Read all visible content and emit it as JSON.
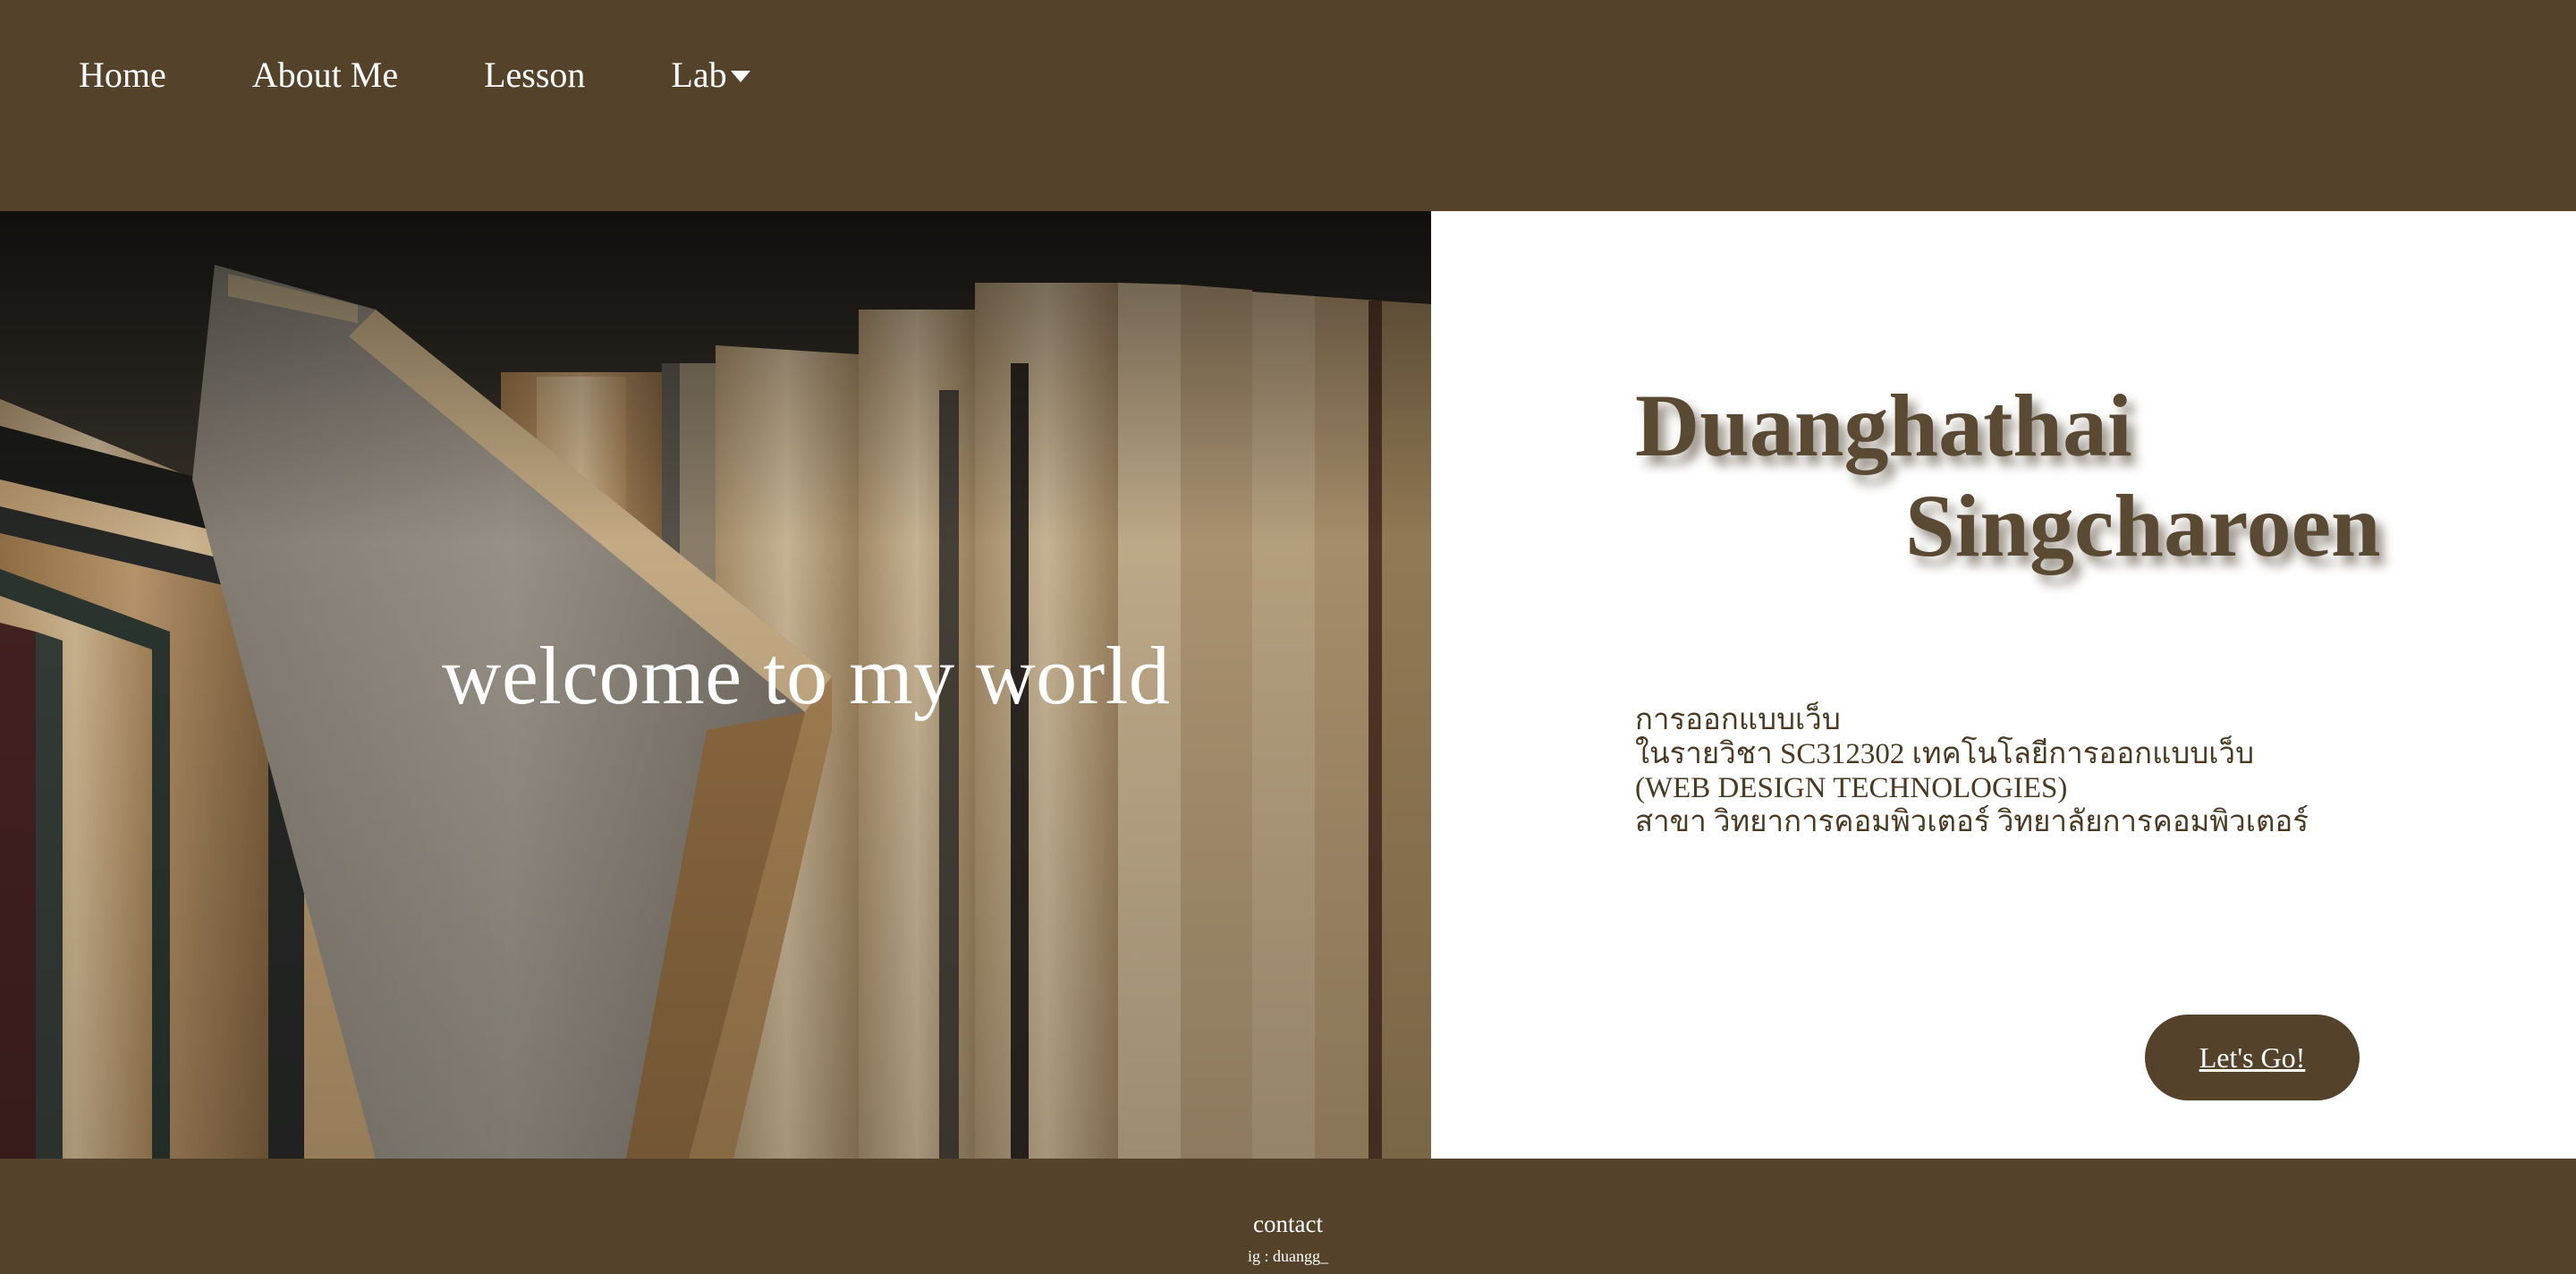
{
  "nav": {
    "items": [
      {
        "label": "Home"
      },
      {
        "label": "About Me"
      },
      {
        "label": "Lesson"
      },
      {
        "label": "Lab"
      }
    ]
  },
  "hero": {
    "welcome": "welcome to my world",
    "image_icon": "bookshelf-photo"
  },
  "profile": {
    "first_name": "Duanghathai",
    "last_name": "Singcharoen",
    "description": [
      "การออกแบบเว็บ",
      "ในรายวิชา SC312302 เทคโนโลยีการออกแบบเว็บ",
      "(WEB DESIGN TECHNOLOGIES)",
      "สาขา วิทยาการคอมพิวเตอร์ วิทยาลัยการคอมพิวเตอร์"
    ],
    "cta_label": "Let's Go!"
  },
  "footer": {
    "contact": "contact",
    "ig": "ig : duangg_"
  },
  "colors": {
    "brand_brown": "#54432a",
    "name_text": "#5a4a33",
    "white": "#ffffff"
  }
}
